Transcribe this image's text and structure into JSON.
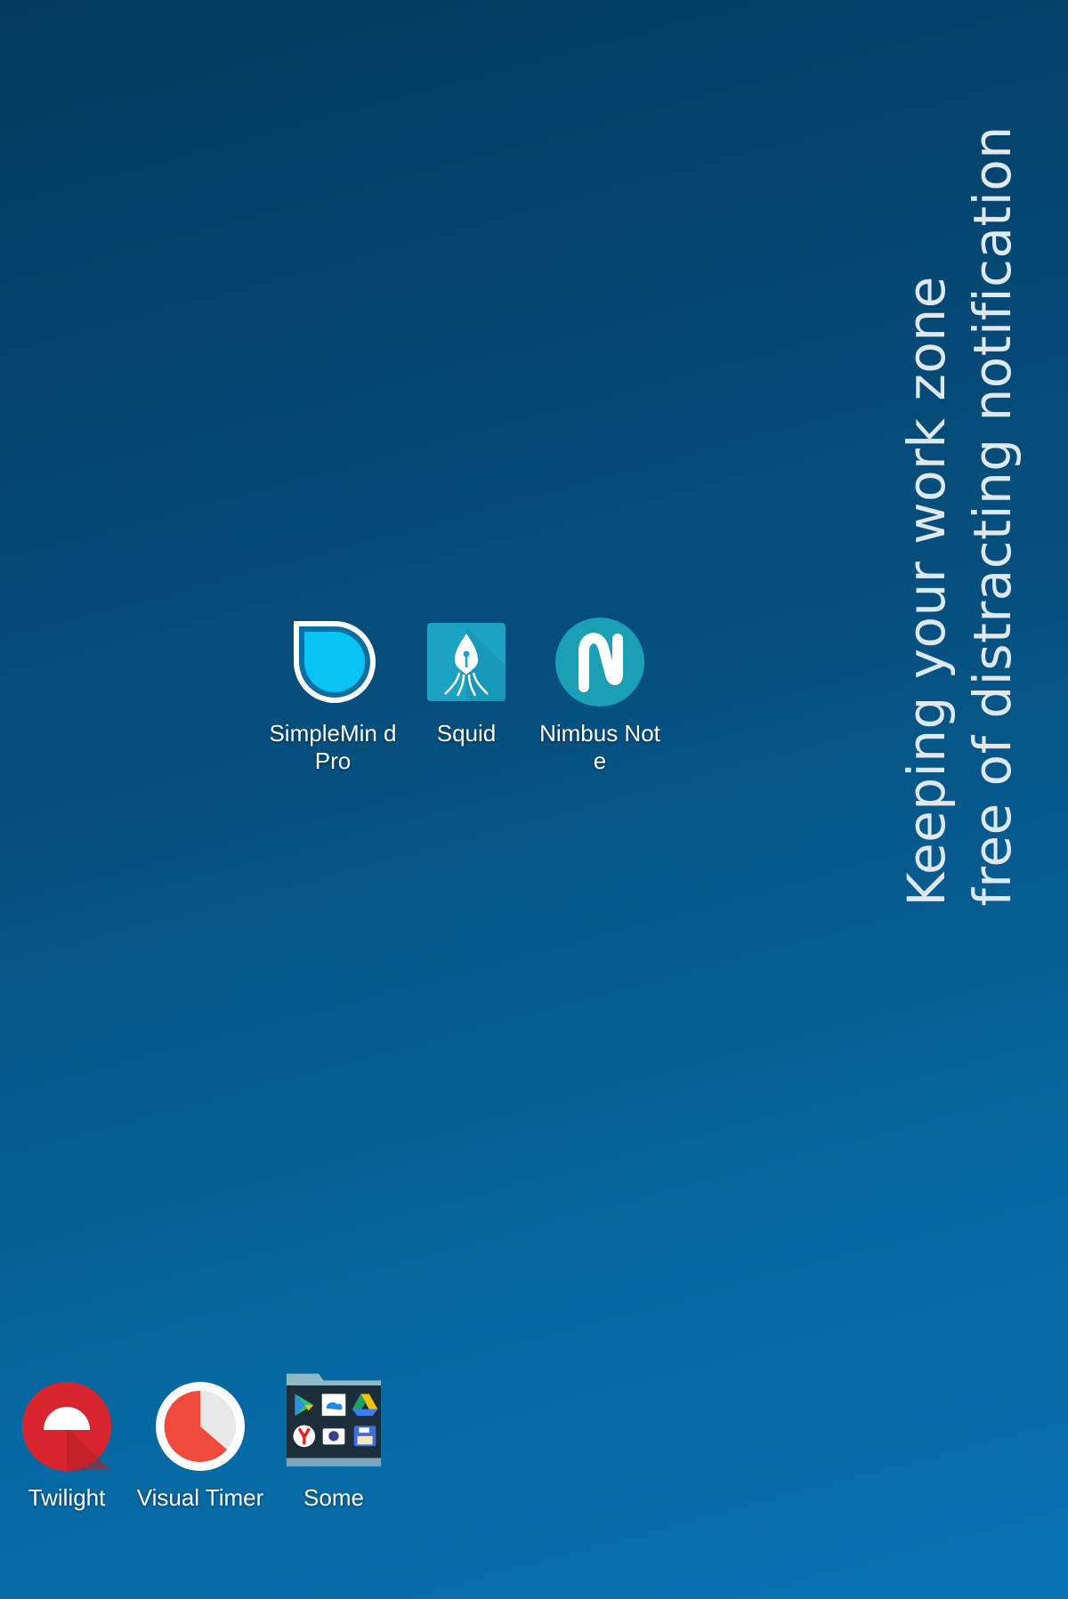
{
  "wallpaper": {
    "line1": "Keeping your work zone",
    "line2": "free of distracting notification"
  },
  "apps": {
    "simplemind": {
      "label": "SimpleMin d Pro",
      "icon": "simplemind-icon"
    },
    "squid": {
      "label": "Squid",
      "icon": "squid-pen-icon"
    },
    "nimbus": {
      "label": "Nimbus Note",
      "icon": "nimbus-n-icon"
    }
  },
  "dock": {
    "twilight": {
      "label": "Twilight",
      "icon": "twilight-icon"
    },
    "visual_timer": {
      "label": "Visual Timer",
      "icon": "visual-timer-icon"
    },
    "folder": {
      "label": "Some",
      "icon": "folder-icon"
    }
  },
  "colors": {
    "background_top": "#043a60",
    "background_bottom": "#0873b2",
    "simplemind": "#08c4f4",
    "squid": "#1ba3c4",
    "nimbus": "#1b9fb5",
    "twilight": "#d9262e",
    "visual_timer": "#ef4a3c"
  }
}
